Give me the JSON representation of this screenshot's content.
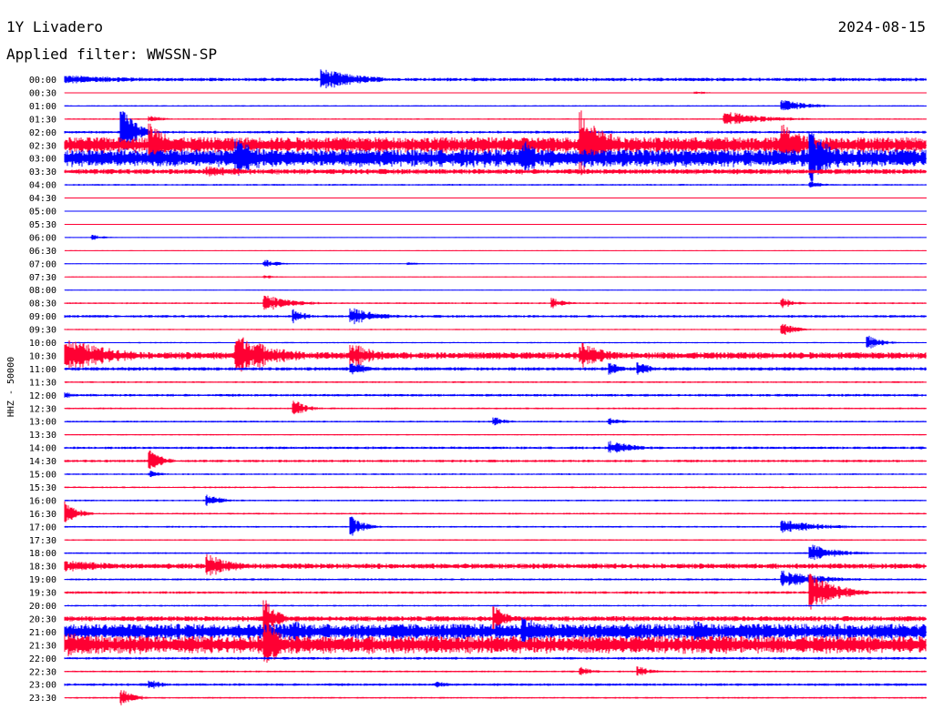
{
  "header": {
    "station": "1Y Livadero",
    "date": "2024-08-15",
    "filter_label": "Applied filter: WWSSN-SP"
  },
  "chart_data": {
    "type": "line",
    "subtype": "helicorder",
    "title": "1Y Livadero",
    "date": "2024-08-15",
    "filter": "WWSSN-SP",
    "ylabel": "HHZ - 50000",
    "colors": {
      "even_rows": "#0000ff",
      "odd_rows": "#ff0033"
    },
    "row_labels": [
      "00:00",
      "00:30",
      "01:00",
      "01:30",
      "02:00",
      "02:30",
      "03:00",
      "03:30",
      "04:00",
      "04:30",
      "05:00",
      "05:30",
      "06:00",
      "06:30",
      "07:00",
      "07:30",
      "08:00",
      "08:30",
      "09:00",
      "09:30",
      "10:00",
      "10:30",
      "11:00",
      "11:30",
      "12:00",
      "12:30",
      "13:00",
      "13:30",
      "14:00",
      "14:30",
      "15:00",
      "15:30",
      "16:00",
      "16:30",
      "17:00",
      "17:30",
      "18:00",
      "18:30",
      "19:00",
      "19:30",
      "20:00",
      "20:30",
      "21:00",
      "21:30",
      "22:00",
      "22:30",
      "23:00",
      "23:30"
    ],
    "row_duration_minutes": 30,
    "noise_amplitude_per_row": [
      2,
      0.5,
      0.8,
      0.8,
      1.5,
      9,
      10,
      3,
      1,
      0.5,
      0.5,
      0.5,
      0.5,
      0.5,
      0.5,
      0.5,
      0.5,
      1,
      1.5,
      0.8,
      0.8,
      4,
      2,
      1,
      1.5,
      1,
      1,
      0.8,
      1.5,
      1.5,
      1,
      1,
      1,
      1,
      1,
      0.8,
      1,
      3,
      1.2,
      1.5,
      1,
      3,
      9,
      10,
      1.5,
      1,
      1.5,
      1
    ],
    "events": [
      {
        "row": 0,
        "minute": 0,
        "duration": 8,
        "amp": 5
      },
      {
        "row": 0,
        "minute": 9,
        "duration": 3,
        "amp": 12
      },
      {
        "row": 1,
        "minute": 22,
        "duration": 1,
        "amp": 2
      },
      {
        "row": 2,
        "minute": 25,
        "duration": 2,
        "amp": 7
      },
      {
        "row": 3,
        "minute": 3,
        "duration": 1,
        "amp": 4
      },
      {
        "row": 3,
        "minute": 23,
        "duration": 3,
        "amp": 9
      },
      {
        "row": 4,
        "minute": 2,
        "duration": 1,
        "amp": 30
      },
      {
        "row": 5,
        "minute": 3,
        "duration": 2,
        "amp": 25
      },
      {
        "row": 5,
        "minute": 18,
        "duration": 2,
        "amp": 40
      },
      {
        "row": 5,
        "minute": 25,
        "duration": 2,
        "amp": 25
      },
      {
        "row": 6,
        "minute": 6,
        "duration": 2,
        "amp": 25
      },
      {
        "row": 6,
        "minute": 16,
        "duration": 2,
        "amp": 20
      },
      {
        "row": 6,
        "minute": 26,
        "duration": 2,
        "amp": 30
      },
      {
        "row": 7,
        "minute": 5,
        "duration": 5,
        "amp": 6
      },
      {
        "row": 8,
        "minute": 26,
        "duration": 1,
        "amp": 4
      },
      {
        "row": 12,
        "minute": 1,
        "duration": 1,
        "amp": 3
      },
      {
        "row": 14,
        "minute": 7,
        "duration": 1,
        "amp": 5
      },
      {
        "row": 14,
        "minute": 12,
        "duration": 1,
        "amp": 2
      },
      {
        "row": 15,
        "minute": 7,
        "duration": 1,
        "amp": 2
      },
      {
        "row": 17,
        "minute": 7,
        "duration": 2,
        "amp": 10
      },
      {
        "row": 17,
        "minute": 17,
        "duration": 1,
        "amp": 6
      },
      {
        "row": 17,
        "minute": 25,
        "duration": 1,
        "amp": 6
      },
      {
        "row": 18,
        "minute": 8,
        "duration": 1,
        "amp": 8
      },
      {
        "row": 18,
        "minute": 10,
        "duration": 2,
        "amp": 10
      },
      {
        "row": 19,
        "minute": 25,
        "duration": 1,
        "amp": 8
      },
      {
        "row": 20,
        "minute": 28,
        "duration": 1,
        "amp": 8
      },
      {
        "row": 21,
        "minute": 0,
        "duration": 4,
        "amp": 20
      },
      {
        "row": 21,
        "minute": 6,
        "duration": 3,
        "amp": 25
      },
      {
        "row": 21,
        "minute": 10,
        "duration": 2,
        "amp": 15
      },
      {
        "row": 21,
        "minute": 18,
        "duration": 2,
        "amp": 15
      },
      {
        "row": 22,
        "minute": 10,
        "duration": 1,
        "amp": 10
      },
      {
        "row": 22,
        "minute": 19,
        "duration": 1,
        "amp": 8
      },
      {
        "row": 22,
        "minute": 20,
        "duration": 1,
        "amp": 9
      },
      {
        "row": 24,
        "minute": 0,
        "duration": 1,
        "amp": 4
      },
      {
        "row": 25,
        "minute": 8,
        "duration": 1,
        "amp": 10
      },
      {
        "row": 26,
        "minute": 15,
        "duration": 1,
        "amp": 5
      },
      {
        "row": 26,
        "minute": 19,
        "duration": 1,
        "amp": 5
      },
      {
        "row": 28,
        "minute": 19,
        "duration": 2,
        "amp": 8
      },
      {
        "row": 29,
        "minute": 3,
        "duration": 1,
        "amp": 12
      },
      {
        "row": 30,
        "minute": 3,
        "duration": 1,
        "amp": 4
      },
      {
        "row": 32,
        "minute": 5,
        "duration": 1,
        "amp": 8
      },
      {
        "row": 33,
        "minute": 0,
        "duration": 1,
        "amp": 14
      },
      {
        "row": 34,
        "minute": 10,
        "duration": 1,
        "amp": 12
      },
      {
        "row": 34,
        "minute": 25,
        "duration": 3,
        "amp": 8
      },
      {
        "row": 36,
        "minute": 26,
        "duration": 2,
        "amp": 10
      },
      {
        "row": 37,
        "minute": 0,
        "duration": 5,
        "amp": 7
      },
      {
        "row": 37,
        "minute": 5,
        "duration": 2,
        "amp": 14
      },
      {
        "row": 38,
        "minute": 25,
        "duration": 3,
        "amp": 10
      },
      {
        "row": 39,
        "minute": 26,
        "duration": 2,
        "amp": 22
      },
      {
        "row": 41,
        "minute": 7,
        "duration": 1,
        "amp": 22
      },
      {
        "row": 41,
        "minute": 15,
        "duration": 1,
        "amp": 14
      },
      {
        "row": 42,
        "minute": 8,
        "duration": 2,
        "amp": 14
      },
      {
        "row": 42,
        "minute": 16,
        "duration": 2,
        "amp": 18
      },
      {
        "row": 42,
        "minute": 22,
        "duration": 2,
        "amp": 14
      },
      {
        "row": 43,
        "minute": 0,
        "duration": 10,
        "amp": 14
      },
      {
        "row": 43,
        "minute": 7,
        "duration": 1,
        "amp": 40
      },
      {
        "row": 45,
        "minute": 18,
        "duration": 1,
        "amp": 5
      },
      {
        "row": 45,
        "minute": 20,
        "duration": 1,
        "amp": 6
      },
      {
        "row": 46,
        "minute": 3,
        "duration": 1,
        "amp": 6
      },
      {
        "row": 46,
        "minute": 13,
        "duration": 1,
        "amp": 4
      },
      {
        "row": 47,
        "minute": 2,
        "duration": 1,
        "amp": 10
      }
    ]
  }
}
